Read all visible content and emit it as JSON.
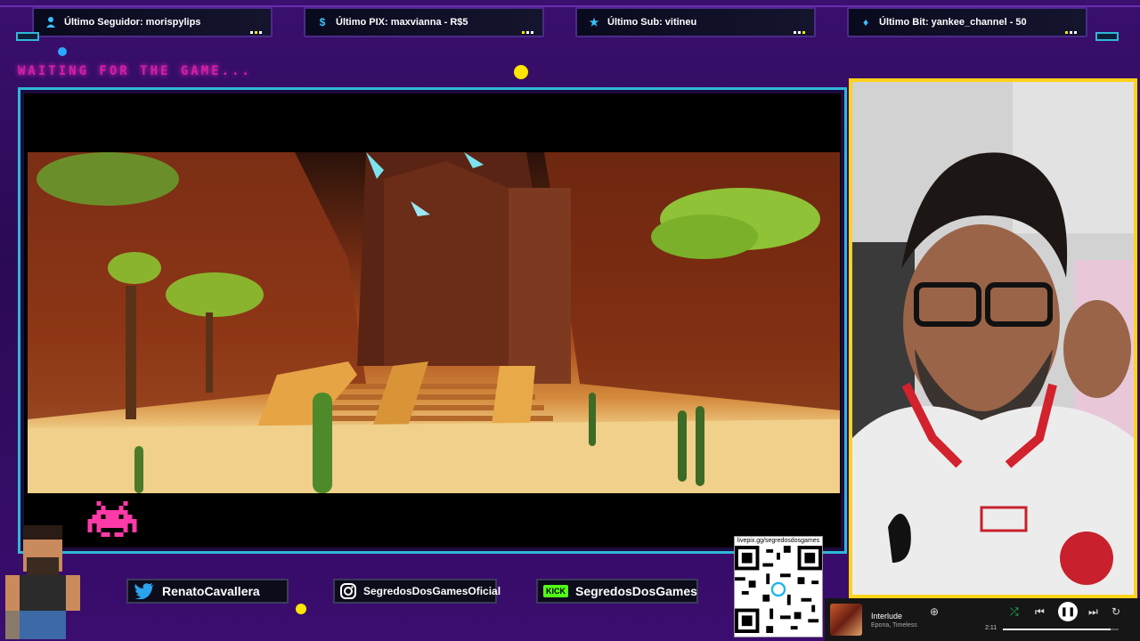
{
  "alerts": [
    {
      "icon": "user-icon",
      "text": "Último Seguidor: morispylips"
    },
    {
      "icon": "dollar-icon",
      "text": "Último PIX: maxvianna - R$5"
    },
    {
      "icon": "star-icon",
      "text": "Último Sub: vitineu"
    },
    {
      "icon": "diamond-icon",
      "text": "Último Bit: yankee_channel - 50"
    }
  ],
  "banner": {
    "waiting": "WAITING FOR THE GAME..."
  },
  "social": {
    "twitter": "RenatoCavallera",
    "instagram": "SegredosDosGamesOficial",
    "kick_badge": "KICK",
    "kick": "SegredosDosGames"
  },
  "qr": {
    "url": "livepix.gg/segredosdosgames"
  },
  "music": {
    "title": "Interlude",
    "artist": "Epona, Timeless",
    "time": "2:11",
    "progress": 0.93
  },
  "colors": {
    "accent_cyan": "#2fb7d8",
    "accent_yellow": "#ffd21a",
    "accent_pink": "#d61fa0",
    "background": "#3a0f6e"
  }
}
